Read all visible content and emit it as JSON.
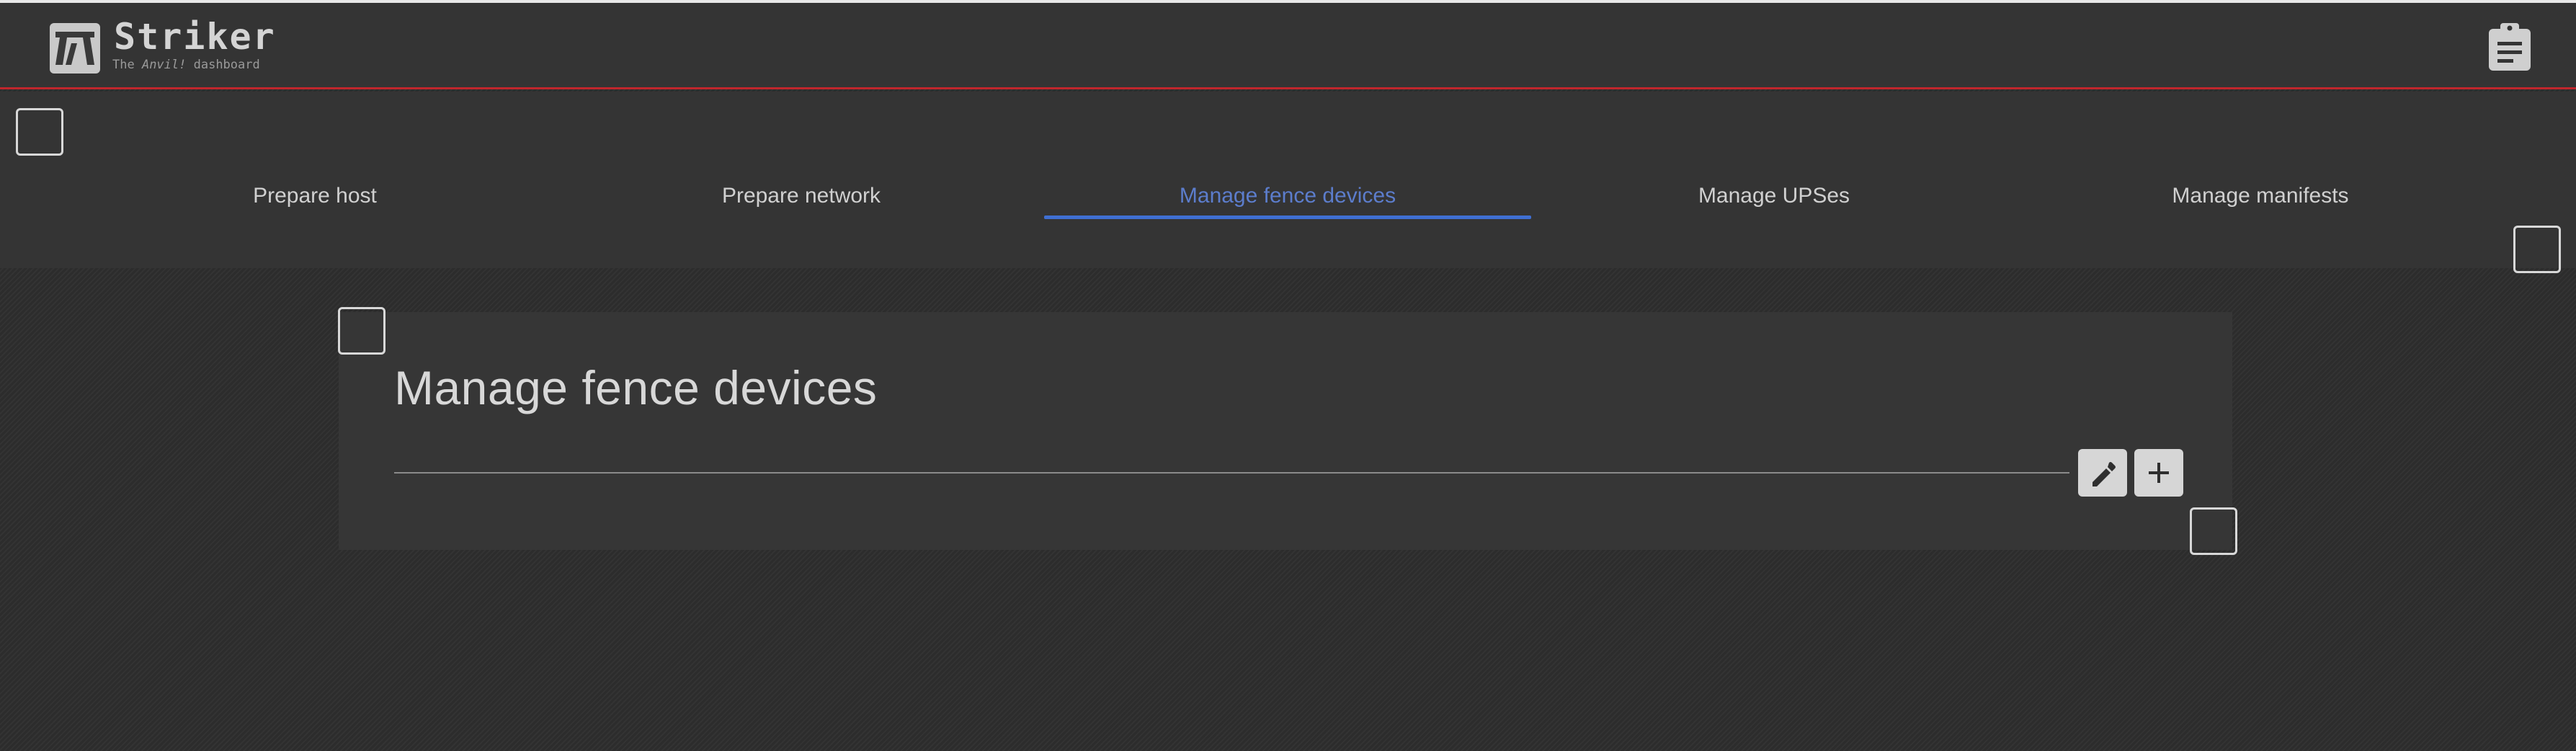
{
  "header": {
    "brand_title": "Striker",
    "brand_sub_prefix": "The ",
    "brand_sub_italic": "Anvil!",
    "brand_sub_suffix": " dashboard",
    "logo_icon": "anvil-logo-icon",
    "right_icon": "clipboard-icon"
  },
  "tabs": [
    {
      "label": "Prepare host",
      "active": false
    },
    {
      "label": "Prepare network",
      "active": false
    },
    {
      "label": "Manage fence devices",
      "active": true
    },
    {
      "label": "Manage UPSes",
      "active": false
    },
    {
      "label": "Manage manifests",
      "active": false
    }
  ],
  "panel": {
    "title": "Manage fence devices",
    "edit_icon": "pencil-icon",
    "add_icon": "plus-icon"
  },
  "colors": {
    "accent": "#3f6fd2",
    "active_tab_text": "#5c7dcc",
    "header_border": "#c0262c"
  }
}
